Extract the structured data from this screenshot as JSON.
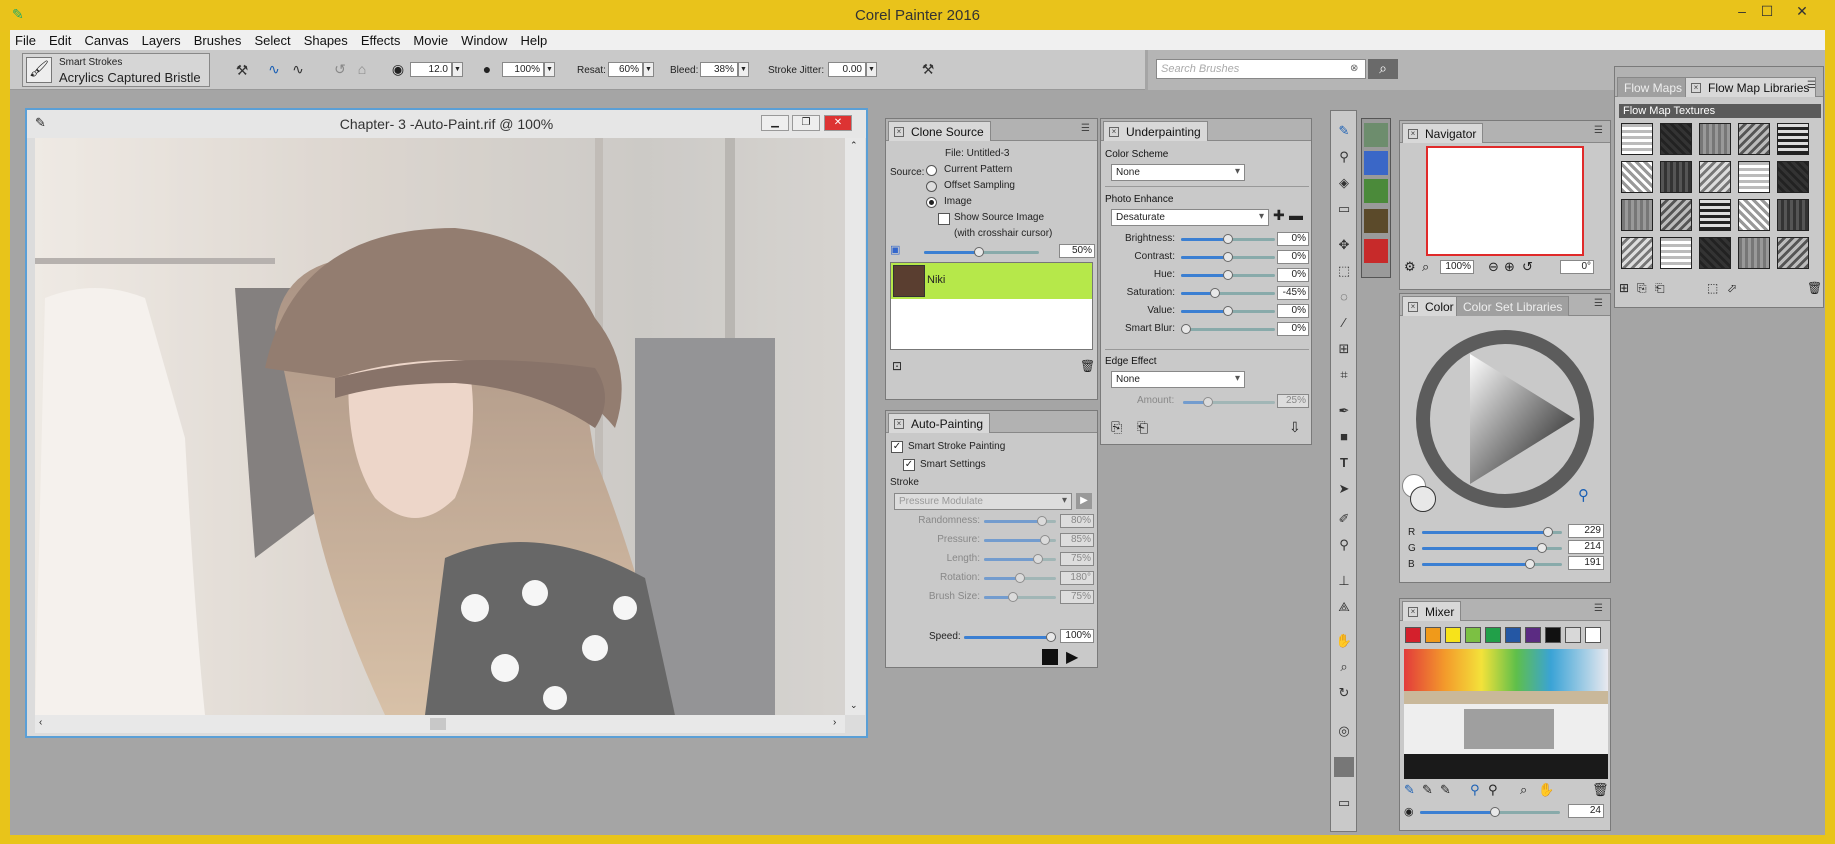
{
  "app": {
    "title": "Corel Painter 2016",
    "window_controls": [
      "–",
      "☐",
      "✕"
    ]
  },
  "menu": [
    "File",
    "Edit",
    "Canvas",
    "Layers",
    "Brushes",
    "Select",
    "Shapes",
    "Effects",
    "Movie",
    "Window",
    "Help"
  ],
  "propbar": {
    "brush_category": "Smart Strokes",
    "brush_variant": "Acrylics Captured Bristle",
    "size": "12.0",
    "opacity": "100%",
    "resat_label": "Resat:",
    "resat": "60%",
    "bleed_label": "Bleed:",
    "bleed": "38%",
    "jitter_label": "Stroke Jitter:",
    "jitter": "0.00"
  },
  "search": {
    "placeholder": "Search Brushes"
  },
  "document": {
    "title": "Chapter- 3 -Auto-Paint.rif @ 100%"
  },
  "clone_source": {
    "tab": "Clone Source",
    "file": "File: Untitled-3",
    "source_label": "Source:",
    "opt_pattern": "Current Pattern",
    "opt_offset": "Offset Sampling",
    "opt_image": "Image",
    "show_source": "Show Source Image",
    "crosshair_note": "(with crosshair cursor)",
    "opacity": "50%",
    "item": "Niki"
  },
  "auto_painting": {
    "tab": "Auto-Painting",
    "smart_stroke": "Smart Stroke Painting",
    "smart_settings": "Smart Settings",
    "stroke_label": "Stroke",
    "stroke_value": "Pressure Modulate",
    "rows": [
      {
        "label": "Randomness:",
        "value": "80%",
        "pct": 0.8
      },
      {
        "label": "Pressure:",
        "value": "85%",
        "pct": 0.85
      },
      {
        "label": "Length:",
        "value": "75%",
        "pct": 0.75
      },
      {
        "label": "Rotation:",
        "value": "180°",
        "pct": 0.5
      },
      {
        "label": "Brush Size:",
        "value": "75%",
        "pct": 0.4
      }
    ],
    "speed_label": "Speed:",
    "speed": "100%"
  },
  "underpainting": {
    "tab": "Underpainting",
    "color_scheme_label": "Color Scheme",
    "color_scheme": "None",
    "photo_enhance_label": "Photo Enhance",
    "photo_enhance": "Desaturate",
    "rows": [
      {
        "label": "Brightness:",
        "value": "0%",
        "pct": 0.5
      },
      {
        "label": "Contrast:",
        "value": "0%",
        "pct": 0.5
      },
      {
        "label": "Hue:",
        "value": "0%",
        "pct": 0.5
      },
      {
        "label": "Saturation:",
        "value": "-45%",
        "pct": 0.36
      },
      {
        "label": "Value:",
        "value": "0%",
        "pct": 0.5
      },
      {
        "label": "Smart Blur:",
        "value": "0%",
        "pct": 0.0
      }
    ],
    "edge_label": "Edge Effect",
    "edge": "None",
    "amount_label": "Amount:",
    "amount": "25%"
  },
  "navigator": {
    "tab": "Navigator",
    "zoom": "100%",
    "rotation": "0°"
  },
  "flow": {
    "tab_off": "Flow Maps",
    "tab_on": "Flow Map Libraries",
    "section": "Flow Map Textures"
  },
  "color": {
    "tab_on": "Color",
    "tab_off": "Color Set Libraries",
    "r_label": "R",
    "r": "229",
    "g_label": "G",
    "g": "214",
    "b_label": "B",
    "b": "191"
  },
  "mixer": {
    "tab": "Mixer",
    "swatches": [
      "#d4202c",
      "#f09a1a",
      "#f7e31a",
      "#7cc043",
      "#21a049",
      "#2457a4",
      "#5b2b82",
      "#111111",
      "#d8d8d8",
      "#ffffff"
    ],
    "brush_size": "24"
  }
}
